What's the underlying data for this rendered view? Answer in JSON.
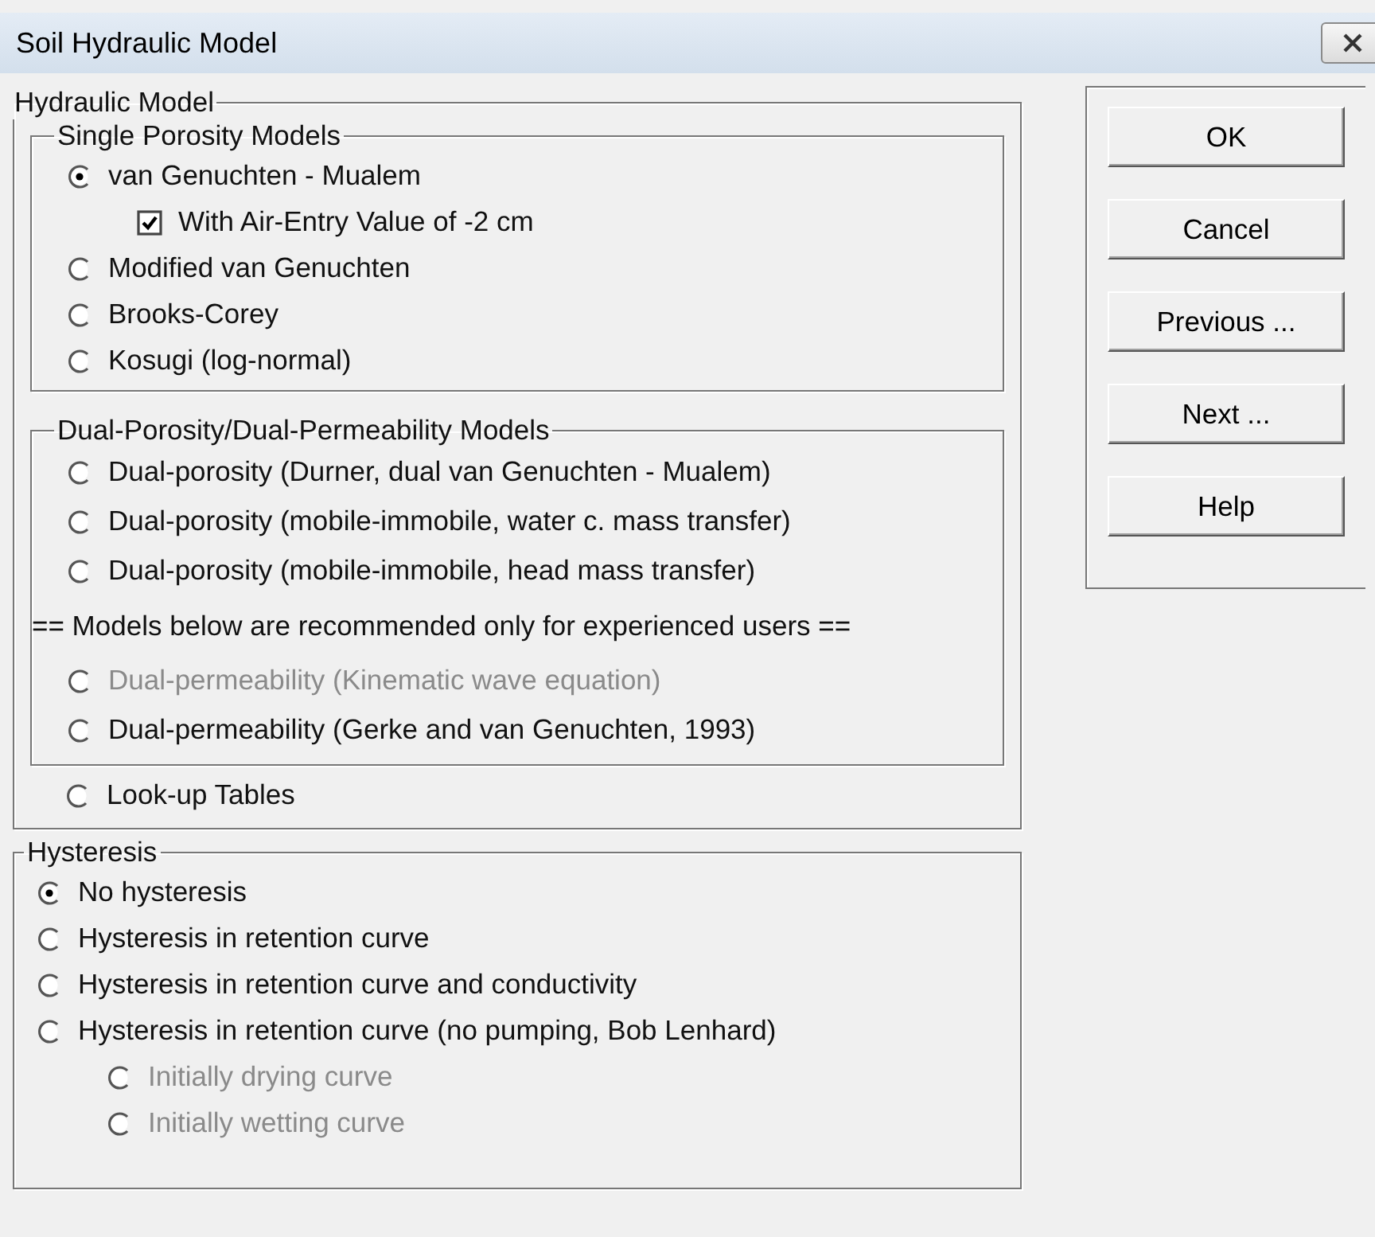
{
  "window": {
    "title": "Soil Hydraulic Model"
  },
  "hydraulic_model": {
    "title": "Hydraulic Model",
    "groups": [
      {
        "title": "Single Porosity Models",
        "items": [
          {
            "kind": "radio",
            "label": "van Genuchten - Mualem",
            "selected": true,
            "disabled": false,
            "children": [
              {
                "kind": "checkbox",
                "label": "With Air-Entry Value of -2 cm",
                "checked": true,
                "disabled": false
              }
            ]
          },
          {
            "kind": "radio",
            "label": "Modified van Genuchten",
            "selected": false,
            "disabled": false
          },
          {
            "kind": "radio",
            "label": "Brooks-Corey",
            "selected": false,
            "disabled": false
          },
          {
            "kind": "radio",
            "label": "Kosugi (log-normal)",
            "selected": false,
            "disabled": false
          }
        ]
      },
      {
        "title": "Dual-Porosity/Dual-Permeability Models",
        "items": [
          {
            "kind": "radio",
            "label": "Dual-porosity (Durner, dual van Genuchten - Mualem)",
            "selected": false,
            "disabled": false
          },
          {
            "kind": "radio",
            "label": "Dual-porosity (mobile-immobile, water c. mass transfer)",
            "selected": false,
            "disabled": false
          },
          {
            "kind": "radio",
            "label": "Dual-porosity (mobile-immobile, head mass transfer)",
            "selected": false,
            "disabled": false
          },
          {
            "kind": "note",
            "label": "== Models below are recommended only for experienced users =="
          },
          {
            "kind": "radio",
            "label": "Dual-permeability (Kinematic wave equation)",
            "selected": false,
            "disabled": true
          },
          {
            "kind": "radio",
            "label": "Dual-permeability (Gerke and van Genuchten, 1993)",
            "selected": false,
            "disabled": false
          }
        ]
      }
    ],
    "items": [
      {
        "kind": "radio",
        "label": "Look-up Tables",
        "selected": false,
        "disabled": false
      }
    ]
  },
  "hysteresis": {
    "title": "Hysteresis",
    "items": [
      {
        "kind": "radio",
        "label": "No hysteresis",
        "selected": true,
        "disabled": false
      },
      {
        "kind": "radio",
        "label": "Hysteresis in retention curve",
        "selected": false,
        "disabled": false
      },
      {
        "kind": "radio",
        "label": "Hysteresis in retention curve and conductivity",
        "selected": false,
        "disabled": false
      },
      {
        "kind": "radio",
        "label": "Hysteresis in retention curve (no pumping, Bob Lenhard)",
        "selected": false,
        "disabled": false,
        "children": [
          {
            "kind": "radio",
            "label": "Initially drying curve",
            "selected": false,
            "disabled": true
          },
          {
            "kind": "radio",
            "label": "Initially wetting curve",
            "selected": false,
            "disabled": true
          }
        ]
      }
    ]
  },
  "buttons": [
    {
      "label": "OK"
    },
    {
      "label": "Cancel"
    },
    {
      "label": "Previous ..."
    },
    {
      "label": "Next ..."
    },
    {
      "label": "Help"
    }
  ]
}
